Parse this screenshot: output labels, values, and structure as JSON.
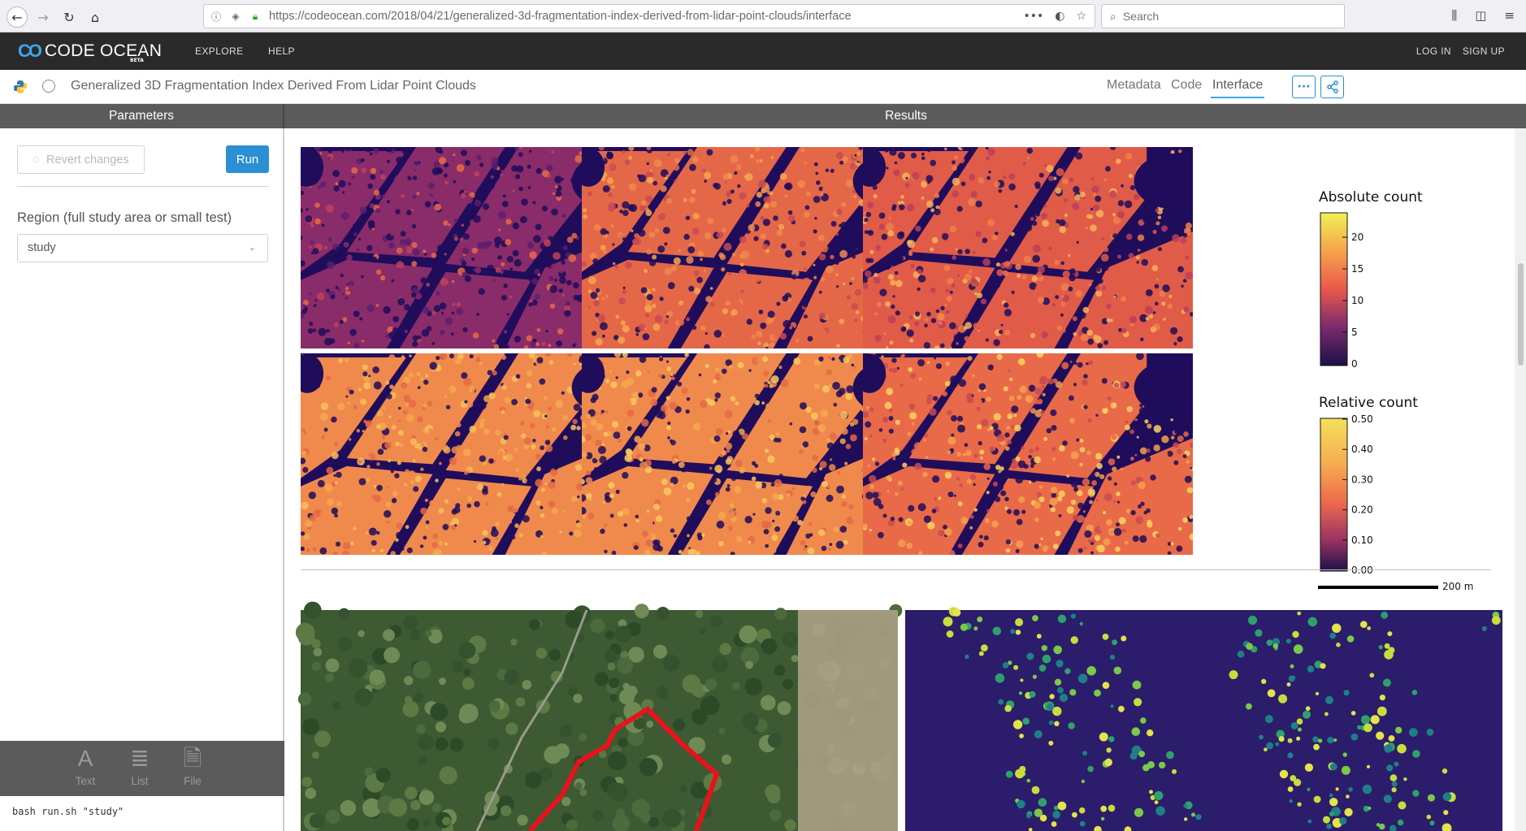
{
  "browser": {
    "url": "https://codeocean.com/2018/04/21/generalized-3d-fragmentation-index-derived-from-lidar-point-clouds/interface",
    "url_host": "codeocean.com",
    "search_placeholder": "Search"
  },
  "header": {
    "logo": "CODE OCEAN",
    "beta": "BETA",
    "nav": [
      "EXPLORE",
      "HELP"
    ],
    "login": "LOG IN",
    "signup": "SIGN UP"
  },
  "capsule": {
    "title": "Generalized 3D Fragmentation Index Derived From Lidar Point Clouds",
    "tabs": [
      "Metadata",
      "Code",
      "Interface"
    ],
    "active_tab": "Interface"
  },
  "panels": {
    "parameters": "Parameters",
    "results": "Results"
  },
  "params": {
    "revert_label": "Revert changes",
    "run_label": "Run",
    "region_label": "Region (full study area or small test)",
    "region_value": "study",
    "format_buttons": [
      "Text",
      "List",
      "File"
    ],
    "command": "bash run.sh \"study\""
  },
  "results": {
    "legend_absolute": {
      "title": "Absolute count",
      "ticks": [
        "20",
        "15",
        "10",
        "5",
        "0"
      ]
    },
    "legend_relative": {
      "title": "Relative count",
      "ticks": [
        "0.50",
        "0.40",
        "0.30",
        "0.20",
        "0.10",
        "0.00"
      ]
    },
    "scalebar": "200 m"
  },
  "colors": {
    "accent": "#2b8fd4",
    "header_bg": "#2a2a2a",
    "panel_header_bg": "#5b5b5b",
    "map_background": "#1f0d5c",
    "route_red": "#e8121c"
  }
}
